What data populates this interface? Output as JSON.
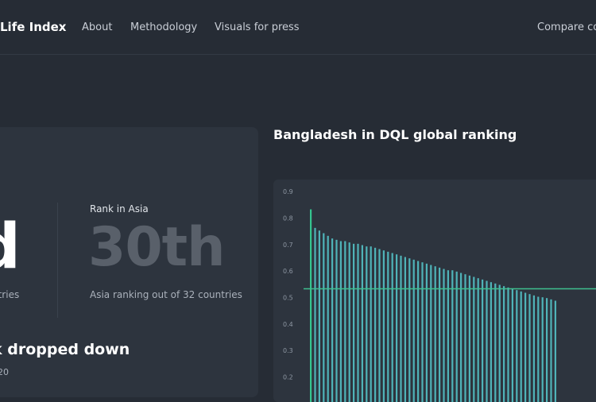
{
  "nav": {
    "brand": "Life Index",
    "links": [
      "About",
      "Methodology",
      "Visuals for press"
    ],
    "compare": "Compare co"
  },
  "global_rank": {
    "value": "d",
    "subtitle": "ntries"
  },
  "asia": {
    "label": "Rank in Asia",
    "value": "30th",
    "subtitle": "Asia ranking out of 32 countries"
  },
  "trend": {
    "headline": "k dropped down",
    "year": "020"
  },
  "chart_title": "Bangladesh in DQL global ranking",
  "colors": {
    "bar": "#4fb3b8",
    "highlight": "#35c48f",
    "reference": "#3fbf8f"
  },
  "chart_data": {
    "type": "bar",
    "title": "Bangladesh in DQL global ranking",
    "xlabel": "",
    "ylabel": "",
    "ylim": [
      0.15,
      0.92
    ],
    "yticks": [
      0.9,
      0.8,
      0.7,
      0.6,
      0.5,
      0.4,
      0.3,
      0.2
    ],
    "reference_line": 0.53,
    "highlight_index": 0,
    "values": [
      0.83,
      0.76,
      0.75,
      0.74,
      0.73,
      0.72,
      0.715,
      0.71,
      0.71,
      0.705,
      0.7,
      0.7,
      0.695,
      0.69,
      0.69,
      0.685,
      0.68,
      0.675,
      0.67,
      0.665,
      0.66,
      0.655,
      0.65,
      0.645,
      0.64,
      0.635,
      0.63,
      0.625,
      0.62,
      0.615,
      0.61,
      0.605,
      0.6,
      0.6,
      0.595,
      0.59,
      0.585,
      0.58,
      0.575,
      0.57,
      0.565,
      0.56,
      0.555,
      0.55,
      0.545,
      0.54,
      0.535,
      0.53,
      0.525,
      0.52,
      0.515,
      0.51,
      0.505,
      0.5,
      0.498,
      0.495,
      0.49,
      0.485
    ]
  }
}
